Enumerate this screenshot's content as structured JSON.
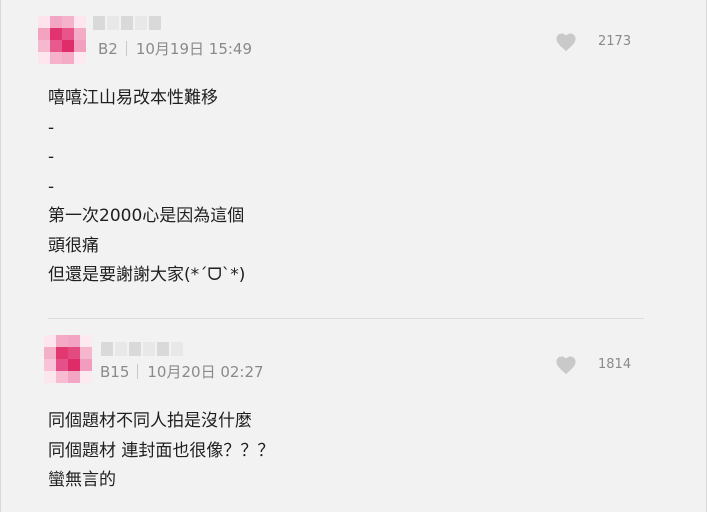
{
  "comments": [
    {
      "floor": "B2",
      "date": "10月19日 15:49",
      "likes": "2173",
      "lines": [
        "嘻嘻江山易改本性難移",
        "-",
        "-",
        "-",
        "第一次2000心是因為這個",
        "頭很痛",
        "但還是要謝謝大家(*ˊᗜˋ*)"
      ]
    },
    {
      "floor": "B15",
      "date": "10月20日 02:27",
      "likes": "1814",
      "lines": [
        "同個題材不同人拍是沒什麼",
        "同個題材 連封面也很像？？？",
        "蠻無言的"
      ]
    }
  ],
  "colors": {
    "heart": "#c9c9c9",
    "avatar_pink": "#e0336f",
    "avatar_light": "#f4a8c4"
  },
  "icons": {
    "like": "heart-icon"
  }
}
